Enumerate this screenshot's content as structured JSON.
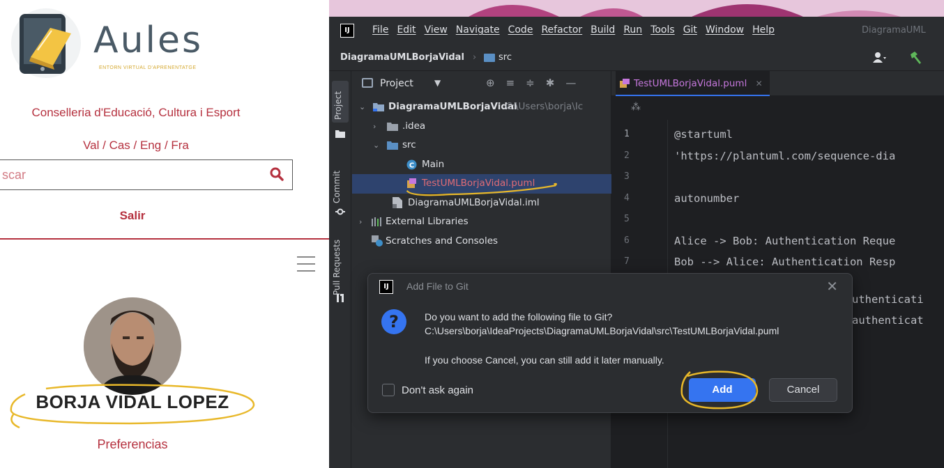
{
  "aules": {
    "logo_title": "Aules",
    "logo_tagline": "ENTORN VIRTUAL D'APRENENTATGE",
    "conselleria": "Conselleria d'Educació, Cultura i Esport",
    "languages": "Val / Cas / Eng / Fra",
    "search_placeholder": "scar",
    "logout": "Salir",
    "user_name": "BORJA VIDAL LOPEZ",
    "preferences": "Preferencias",
    "colors": {
      "brand_red": "#b5303e",
      "logo_gold": "#d4a72c"
    }
  },
  "ide": {
    "menu": [
      "File",
      "Edit",
      "View",
      "Navigate",
      "Code",
      "Refactor",
      "Build",
      "Run",
      "Tools",
      "Git",
      "Window",
      "Help"
    ],
    "window_title": "DiagramaUML",
    "breadcrumb": {
      "project": "DiagramaUMLBorjaVidal",
      "folder": "src"
    },
    "side_tabs": {
      "project": "Project",
      "commit": "Commit",
      "pull_requests": "Pull Requests"
    },
    "panel_title": "Project",
    "tree": {
      "root": "DiagramaUMLBorjaVidal",
      "root_path": "C:\\Users\\borja\\Ic",
      "idea": ".idea",
      "src": "src",
      "main": "Main",
      "puml": "TestUMLBorjaVidal.puml",
      "iml": "DiagramaUMLBorjaVidal.iml",
      "external_libraries": "External Libraries",
      "scratches": "Scratches and Consoles"
    },
    "editor_tab": "TestUMLBorjaVidal.puml",
    "line_numbers": [
      "1",
      "2",
      "3",
      "4",
      "5",
      "6",
      "7"
    ],
    "code_lines": [
      "@startuml",
      "'https://plantuml.com/sequence-dia",
      "",
      "autonumber",
      "",
      "Alice -> Bob: Authentication Reque",
      "Bob --> Alice: Authentication Resp"
    ],
    "code_overflow": [
      "uthenticati",
      "authenticat"
    ],
    "colors": {
      "accent_blue": "#3574f0",
      "selection": "#2e436e",
      "editor_bg": "#1e1f22"
    }
  },
  "dialog": {
    "title": "Add File to Git",
    "question": "Do you want to add the following file to Git?",
    "path": "C:\\Users\\borja\\IdeaProjects\\DiagramaUMLBorjaVidal\\src\\TestUMLBorjaVidal.puml",
    "note": "If you choose Cancel, you can still add it later manually.",
    "checkbox_label": "Don't ask again",
    "checkbox_checked": false,
    "add_label": "Add",
    "cancel_label": "Cancel",
    "icon": "question-icon"
  },
  "annotations": {
    "highlight_color": "#e8b82a"
  }
}
